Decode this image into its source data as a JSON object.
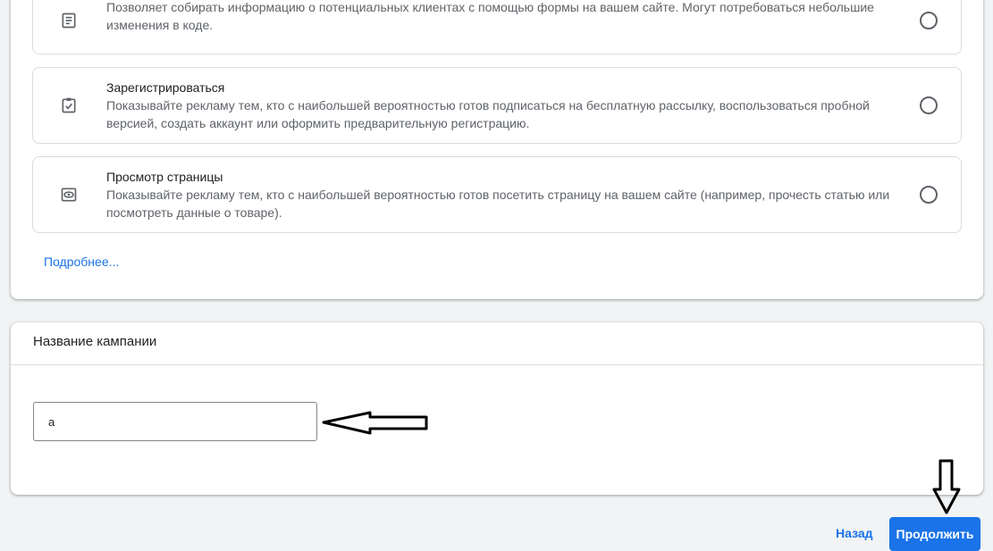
{
  "goals": {
    "options": [
      {
        "icon": "form-icon",
        "title": "",
        "description": "Позволяет собирать информацию о потенциальных клиентах с помощью формы на вашем сайте. Могут потребоваться небольшие изменения в коде."
      },
      {
        "icon": "checklist-clipboard-icon",
        "title": "Зарегистрироваться",
        "description": "Показывайте рекламу тем, кто с наибольшей вероятностью готов подписаться на бесплатную рассылку, воспользоваться пробной версией, создать аккаунт или оформить предварительную регистрацию."
      },
      {
        "icon": "eye-icon",
        "title": "Просмотр страницы",
        "description": "Показывайте рекламу тем, кто с наибольшей вероятностью готов посетить страницу на вашем сайте (например, прочесть статью или посмотреть данные о товаре)."
      }
    ],
    "more_link": "Подробнее..."
  },
  "campaign_name": {
    "title": "Название кампании",
    "input_value": "a"
  },
  "footer": {
    "back_label": "Назад",
    "continue_label": "Продолжить"
  },
  "colors": {
    "accent": "#1a73e8",
    "background": "#f1f3f4"
  }
}
